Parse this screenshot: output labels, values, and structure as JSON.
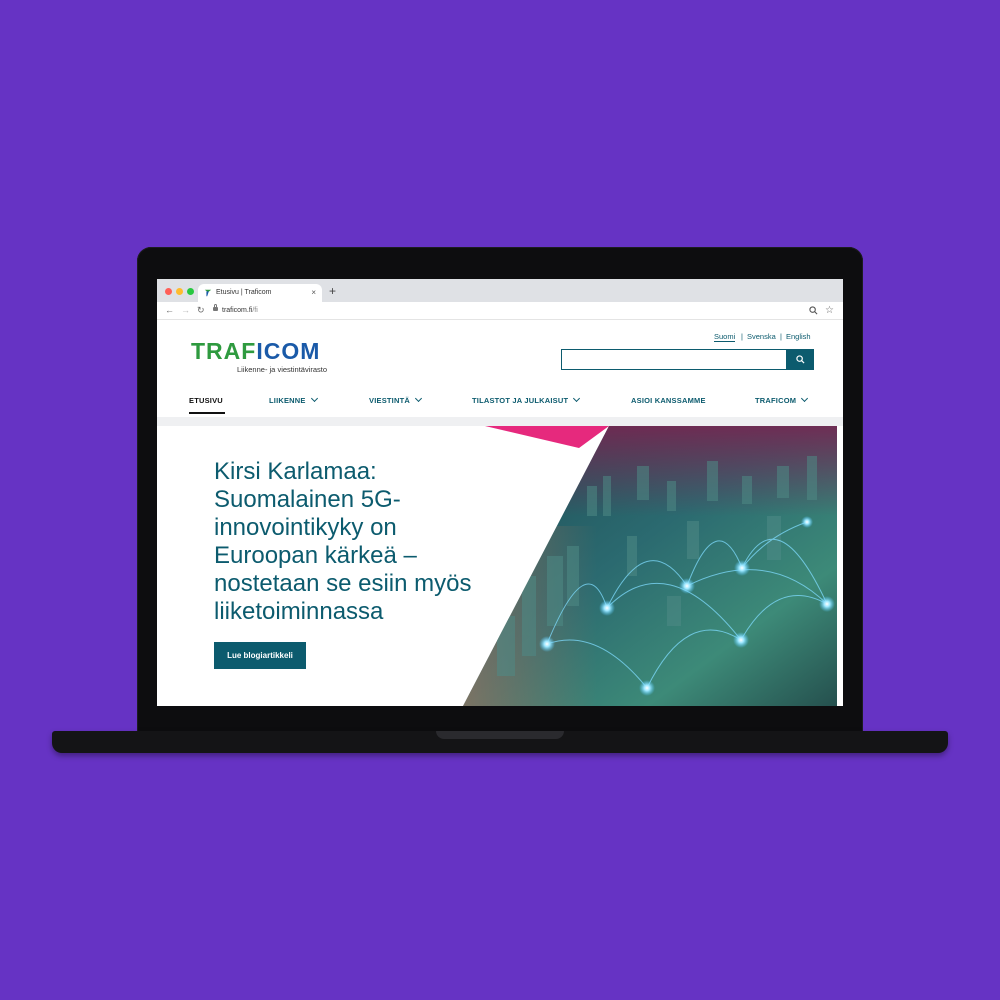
{
  "browser": {
    "tab_title": "Etusivu | Traficom",
    "tab_close": "×",
    "new_tab": "+",
    "url_domain": "traficom.fi",
    "url_path": "/fi"
  },
  "header": {
    "logo_part1": "TRAF",
    "logo_part2": "ICOM",
    "logo_subtitle": "Liikenne- ja viestintävirasto",
    "languages": [
      "Suomi",
      "Svenska",
      "English"
    ],
    "lang_separator": "|",
    "search_value": "",
    "search_icon": "search-icon"
  },
  "nav": {
    "items": [
      {
        "label": "ETUSIVU",
        "has_dropdown": false
      },
      {
        "label": "LIIKENNE",
        "has_dropdown": true
      },
      {
        "label": "VIESTINTÄ",
        "has_dropdown": true
      },
      {
        "label": "TILASTOT JA JULKAISUT",
        "has_dropdown": true
      },
      {
        "label": "ASIOI KANSSAMME",
        "has_dropdown": false
      },
      {
        "label": "TRAFICOM",
        "has_dropdown": true
      }
    ]
  },
  "hero": {
    "title": "Kirsi Karlamaa: Suomalainen 5G-innovointikyky on Euroopan kärkeä – nostetaan se esiin myös liiketoiminnassa",
    "button_label": "Lue blogiartikkeli"
  },
  "colors": {
    "background": "#6633c4",
    "brand_teal": "#0c5b6e",
    "brand_green": "#2e9a3f",
    "brand_blue": "#1a5aa8",
    "accent_pink": "#e6297d"
  }
}
